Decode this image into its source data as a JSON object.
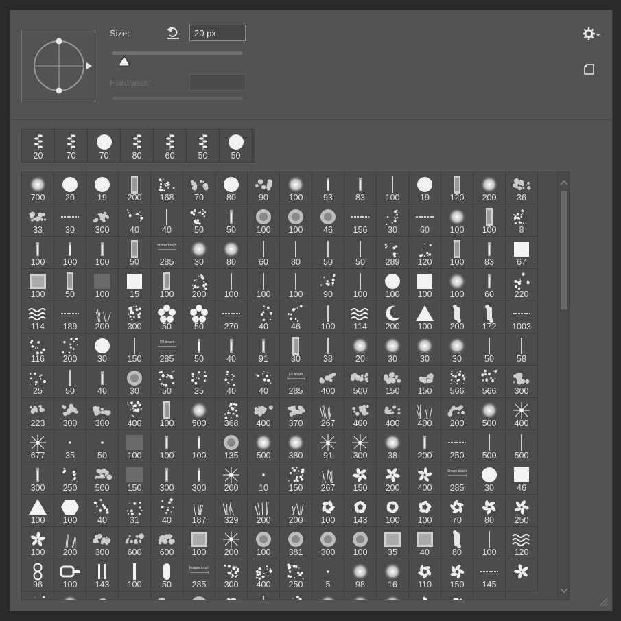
{
  "brush_settings": {
    "size_label": "Size:",
    "size_value": "20 px",
    "hardness_label": "Hardness:",
    "hardness_value": "",
    "size_slider_level": 0.08
  },
  "icons": {
    "reset": "reset-arrow-icon",
    "gear": "gear-icon",
    "new_preset": "new-preset-icon",
    "angle_preview": "brush-angle-preview-icon"
  },
  "recent_brushes": [
    {
      "size": "20",
      "shape": "sprig"
    },
    {
      "size": "70",
      "shape": "sprig"
    },
    {
      "size": "70",
      "shape": "hard-round"
    },
    {
      "size": "80",
      "shape": "sprig"
    },
    {
      "size": "60",
      "shape": "sprig"
    },
    {
      "size": "50",
      "shape": "sprig"
    },
    {
      "size": "50",
      "shape": "hard-round"
    }
  ],
  "brush_presets": [
    {
      "size": "700",
      "shape": "soft-round"
    },
    {
      "size": "20",
      "shape": "hard-round"
    },
    {
      "size": "19",
      "shape": "hard-round"
    },
    {
      "size": "200",
      "shape": "texture-rect"
    },
    {
      "size": "168",
      "shape": "splatter"
    },
    {
      "size": "70",
      "shape": "cloud"
    },
    {
      "size": "80",
      "shape": "hard-round"
    },
    {
      "size": "90",
      "shape": "cloud"
    },
    {
      "size": "100",
      "shape": "soft-round"
    },
    {
      "size": "93",
      "shape": "bristle"
    },
    {
      "size": "83",
      "shape": "bristle"
    },
    {
      "size": "100",
      "shape": "line"
    },
    {
      "size": "19",
      "shape": "hard-round"
    },
    {
      "size": "120",
      "shape": "texture-rect"
    },
    {
      "size": "200",
      "shape": "soft-round"
    },
    {
      "size": "36",
      "shape": "cloud"
    },
    {
      "size": "33",
      "shape": "cloud"
    },
    {
      "size": "30",
      "shape": "dash"
    },
    {
      "size": "300",
      "shape": "cloud"
    },
    {
      "size": "40",
      "shape": "scatter"
    },
    {
      "size": "40",
      "shape": "line"
    },
    {
      "size": "50",
      "shape": "splatter"
    },
    {
      "size": "50",
      "shape": "bristle"
    },
    {
      "size": "100",
      "shape": "texture-round"
    },
    {
      "size": "100",
      "shape": "texture-round"
    },
    {
      "size": "46",
      "shape": "texture-round"
    },
    {
      "size": "156",
      "shape": "dash"
    },
    {
      "size": "30",
      "shape": "scatter"
    },
    {
      "size": "60",
      "shape": "dash"
    },
    {
      "size": "100",
      "shape": "soft-round"
    },
    {
      "size": "100",
      "shape": "texture-rect"
    },
    {
      "size": "8",
      "shape": "splatter"
    },
    {
      "size": "100",
      "shape": "bristle"
    },
    {
      "size": "100",
      "shape": "bristle"
    },
    {
      "size": "100",
      "shape": "bristle"
    },
    {
      "size": "50",
      "shape": "texture-rect"
    },
    {
      "size": "285",
      "shape": "label-stroke"
    },
    {
      "size": "30",
      "shape": "soft-round"
    },
    {
      "size": "80",
      "shape": "soft-round"
    },
    {
      "size": "60",
      "shape": "line"
    },
    {
      "size": "80",
      "shape": "line"
    },
    {
      "size": "50",
      "shape": "line"
    },
    {
      "size": "50",
      "shape": "line"
    },
    {
      "size": "289",
      "shape": "scatter"
    },
    {
      "size": "120",
      "shape": "scatter"
    },
    {
      "size": "100",
      "shape": "texture-rect"
    },
    {
      "size": "83",
      "shape": "bristle"
    },
    {
      "size": "67",
      "shape": "square"
    },
    {
      "size": "100",
      "shape": "texture-square"
    },
    {
      "size": "50",
      "shape": "texture-rect"
    },
    {
      "size": "100",
      "shape": "soft-square"
    },
    {
      "size": "15",
      "shape": "square"
    },
    {
      "size": "100",
      "shape": "texture-rect"
    },
    {
      "size": "200",
      "shape": "splatter"
    },
    {
      "size": "100",
      "shape": "line"
    },
    {
      "size": "100",
      "shape": "line"
    },
    {
      "size": "100",
      "shape": "line"
    },
    {
      "size": "90",
      "shape": "scatter"
    },
    {
      "size": "100",
      "shape": "line"
    },
    {
      "size": "100",
      "shape": "hard-round"
    },
    {
      "size": "100",
      "shape": "square"
    },
    {
      "size": "100",
      "shape": "soft-round"
    },
    {
      "size": "60",
      "shape": "bristle"
    },
    {
      "size": "220",
      "shape": "scatter"
    },
    {
      "size": "114",
      "shape": "wave"
    },
    {
      "size": "189",
      "shape": "dash"
    },
    {
      "size": "200",
      "shape": "grass"
    },
    {
      "size": "300",
      "shape": "splatter"
    },
    {
      "size": "50",
      "shape": "flower"
    },
    {
      "size": "50",
      "shape": "flower"
    },
    {
      "size": "270",
      "shape": "dash"
    },
    {
      "size": "40",
      "shape": "dots-line"
    },
    {
      "size": "46",
      "shape": "dots-line"
    },
    {
      "size": "100",
      "shape": "line"
    },
    {
      "size": "114",
      "shape": "wave"
    },
    {
      "size": "200",
      "shape": "moon"
    },
    {
      "size": "100",
      "shape": "triangle"
    },
    {
      "size": "200",
      "shape": "bone"
    },
    {
      "size": "172",
      "shape": "bone"
    },
    {
      "size": "1003",
      "shape": "dash"
    },
    {
      "size": "116",
      "shape": "scatter"
    },
    {
      "size": "200",
      "shape": "scatter"
    },
    {
      "size": "30",
      "shape": "hard-round"
    },
    {
      "size": "150",
      "shape": "line"
    },
    {
      "size": "285",
      "shape": "label-stroke"
    },
    {
      "size": "50",
      "shape": "bristle"
    },
    {
      "size": "40",
      "shape": "bristle"
    },
    {
      "size": "91",
      "shape": "bristle"
    },
    {
      "size": "80",
      "shape": "texture-rect"
    },
    {
      "size": "38",
      "shape": "line"
    },
    {
      "size": "20",
      "shape": "soft-round"
    },
    {
      "size": "30",
      "shape": "soft-round"
    },
    {
      "size": "30",
      "shape": "soft-round"
    },
    {
      "size": "30",
      "shape": "soft-round"
    },
    {
      "size": "50",
      "shape": "line"
    },
    {
      "size": "58",
      "shape": "line"
    },
    {
      "size": "25",
      "shape": "scatter"
    },
    {
      "size": "50",
      "shape": "line"
    },
    {
      "size": "40",
      "shape": "bristle"
    },
    {
      "size": "30",
      "shape": "texture-round"
    },
    {
      "size": "50",
      "shape": "splatter"
    },
    {
      "size": "25",
      "shape": "scatter"
    },
    {
      "size": "40",
      "shape": "scatter"
    },
    {
      "size": "40",
      "shape": "scatter"
    },
    {
      "size": "285",
      "shape": "label-stroke"
    },
    {
      "size": "400",
      "shape": "cloud"
    },
    {
      "size": "500",
      "shape": "cloud"
    },
    {
      "size": "150",
      "shape": "cloud"
    },
    {
      "size": "150",
      "shape": "cloud"
    },
    {
      "size": "566",
      "shape": "splatter"
    },
    {
      "size": "566",
      "shape": "splatter"
    },
    {
      "size": "300",
      "shape": "cloud"
    },
    {
      "size": "223",
      "shape": "cloud"
    },
    {
      "size": "300",
      "shape": "cloud"
    },
    {
      "size": "300",
      "shape": "cloud"
    },
    {
      "size": "400",
      "shape": "splatter"
    },
    {
      "size": "100",
      "shape": "texture-rect"
    },
    {
      "size": "500",
      "shape": "soft-round"
    },
    {
      "size": "368",
      "shape": "splatter"
    },
    {
      "size": "400",
      "shape": "cloud"
    },
    {
      "size": "370",
      "shape": "cloud"
    },
    {
      "size": "267",
      "shape": "grass"
    },
    {
      "size": "400",
      "shape": "cloud"
    },
    {
      "size": "400",
      "shape": "cloud"
    },
    {
      "size": "400",
      "shape": "grass"
    },
    {
      "size": "200",
      "shape": "cloud"
    },
    {
      "size": "500",
      "shape": "soft-round"
    },
    {
      "size": "400",
      "shape": "star"
    },
    {
      "size": "677",
      "shape": "star"
    },
    {
      "size": "35",
      "shape": "dot"
    },
    {
      "size": "50",
      "shape": "dot"
    },
    {
      "size": "100",
      "shape": "soft-square"
    },
    {
      "size": "100",
      "shape": "bristle"
    },
    {
      "size": "100",
      "shape": "bristle"
    },
    {
      "size": "135",
      "shape": "texture-round"
    },
    {
      "size": "500",
      "shape": "soft-round"
    },
    {
      "size": "380",
      "shape": "soft-round"
    },
    {
      "size": "91",
      "shape": "star"
    },
    {
      "size": "300",
      "shape": "star"
    },
    {
      "size": "38",
      "shape": "soft-round"
    },
    {
      "size": "200",
      "shape": "bristle"
    },
    {
      "size": "250",
      "shape": "dash"
    },
    {
      "size": "500",
      "shape": "line"
    },
    {
      "size": "500",
      "shape": "line"
    },
    {
      "size": "300",
      "shape": "bristle"
    },
    {
      "size": "250",
      "shape": "scatter"
    },
    {
      "size": "500",
      "shape": "cloud"
    },
    {
      "size": "150",
      "shape": "soft-square"
    },
    {
      "size": "300",
      "shape": "bristle"
    },
    {
      "size": "300",
      "shape": "bristle"
    },
    {
      "size": "200",
      "shape": "star"
    },
    {
      "size": "10",
      "shape": "dot"
    },
    {
      "size": "150",
      "shape": "splatter"
    },
    {
      "size": "267",
      "shape": "grass"
    },
    {
      "size": "150",
      "shape": "leaf"
    },
    {
      "size": "200",
      "shape": "leaf"
    },
    {
      "size": "400",
      "shape": "leaf"
    },
    {
      "size": "285",
      "shape": "label-stroke"
    },
    {
      "size": "30",
      "shape": "hard-round"
    },
    {
      "size": "46",
      "shape": "square"
    },
    {
      "size": "100",
      "shape": "triangle"
    },
    {
      "size": "100",
      "shape": "hexagon"
    },
    {
      "size": "40",
      "shape": "scatter"
    },
    {
      "size": "31",
      "shape": "scatter"
    },
    {
      "size": "40",
      "shape": "scatter"
    },
    {
      "size": "187",
      "shape": "grass"
    },
    {
      "size": "329",
      "shape": "grass"
    },
    {
      "size": "200",
      "shape": "grass"
    },
    {
      "size": "200",
      "shape": "grass"
    },
    {
      "size": "100",
      "shape": "leaf"
    },
    {
      "size": "143",
      "shape": "leaf"
    },
    {
      "size": "100",
      "shape": "leaf"
    },
    {
      "size": "100",
      "shape": "leaf"
    },
    {
      "size": "70",
      "shape": "leaf"
    },
    {
      "size": "80",
      "shape": "leaf"
    },
    {
      "size": "250",
      "shape": "leaf"
    },
    {
      "size": "100",
      "shape": "leaf"
    },
    {
      "size": "200",
      "shape": "grass"
    },
    {
      "size": "300",
      "shape": "cloud"
    },
    {
      "size": "600",
      "shape": "cloud"
    },
    {
      "size": "600",
      "shape": "cloud"
    },
    {
      "size": "100",
      "shape": "texture-square"
    },
    {
      "size": "200",
      "shape": "star"
    },
    {
      "size": "100",
      "shape": "texture-round"
    },
    {
      "size": "381",
      "shape": "texture-round"
    },
    {
      "size": "300",
      "shape": "texture-round"
    },
    {
      "size": "100",
      "shape": "texture-round"
    },
    {
      "size": "35",
      "shape": "texture-square"
    },
    {
      "size": "40",
      "shape": "texture-square"
    },
    {
      "size": "80",
      "shape": "bone"
    },
    {
      "size": "100",
      "shape": "line"
    },
    {
      "size": "120",
      "shape": "wave"
    },
    {
      "size": "96",
      "shape": "rings"
    },
    {
      "size": "100",
      "shape": "chain"
    },
    {
      "size": "143",
      "shape": "bars"
    },
    {
      "size": "100",
      "shape": "bar"
    },
    {
      "size": "50",
      "shape": "pill"
    },
    {
      "size": "285",
      "shape": "label-stroke"
    },
    {
      "size": "300",
      "shape": "splatter"
    },
    {
      "size": "400",
      "shape": "splatter"
    },
    {
      "size": "250",
      "shape": "splatter"
    },
    {
      "size": "5",
      "shape": "dot"
    },
    {
      "size": "98",
      "shape": "soft-round"
    },
    {
      "size": "16",
      "shape": "soft-round"
    },
    {
      "size": "110",
      "shape": "leaf"
    },
    {
      "size": "150",
      "shape": "leaf"
    },
    {
      "size": "145",
      "shape": "dash"
    },
    {
      "size": "",
      "shape": "leaf"
    },
    {
      "size": "",
      "shape": "scatter"
    },
    {
      "size": "",
      "shape": "soft-round"
    },
    {
      "size": "",
      "shape": "cloud"
    },
    {
      "size": "",
      "shape": "cloud"
    },
    {
      "size": "",
      "shape": "cloud"
    },
    {
      "size": "",
      "shape": "texture-round"
    },
    {
      "size": "",
      "shape": "leaf"
    },
    {
      "size": "",
      "shape": "line"
    },
    {
      "size": "",
      "shape": "scatter"
    },
    {
      "size": "",
      "shape": "soft-round"
    },
    {
      "size": "",
      "shape": "soft-round"
    },
    {
      "size": "",
      "shape": "soft-round"
    },
    {
      "size": "",
      "shape": "leaf"
    },
    {
      "size": "",
      "shape": "leaf"
    },
    {
      "size": "",
      "shape": "dash"
    }
  ],
  "stroke_labels": [
    "Stylize brush",
    "Oil brush",
    "FX brush",
    "Shape brush",
    "Texture brush"
  ]
}
